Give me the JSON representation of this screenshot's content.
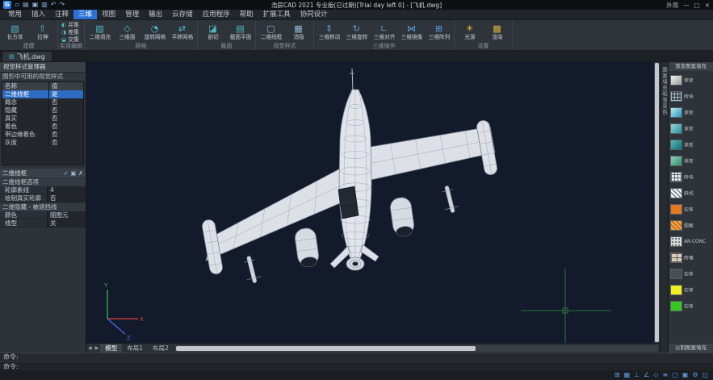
{
  "window": {
    "logo_text": "G",
    "title": "浩辰CAD 2021 专业版(已过期)[Trial day left 0] - [飞机.dwg]",
    "appearance": "外观",
    "minimize": "—",
    "maximize": "□",
    "close": "×"
  },
  "quick_access": {
    "icons": [
      {
        "name": "new-file-icon",
        "glyph": "▱"
      },
      {
        "name": "open-folder-icon",
        "glyph": "▤"
      },
      {
        "name": "save-icon",
        "glyph": "▣"
      },
      {
        "name": "plot-icon",
        "glyph": "▥"
      },
      {
        "name": "undo-icon",
        "glyph": "↶"
      },
      {
        "name": "redo-icon",
        "glyph": "↷"
      }
    ]
  },
  "menu": {
    "tabs": [
      {
        "label": "常用"
      },
      {
        "label": "插入"
      },
      {
        "label": "注释"
      },
      {
        "label": "三维",
        "active": true
      },
      {
        "label": "视图"
      },
      {
        "label": "管理"
      },
      {
        "label": "输出"
      },
      {
        "label": "云存储"
      },
      {
        "label": "应用程序"
      },
      {
        "label": "帮助"
      },
      {
        "label": "扩展工具"
      },
      {
        "label": "协同设计"
      }
    ]
  },
  "ribbon": {
    "groups": [
      {
        "label": "建模",
        "icon_color": "#4db8c8",
        "buttons": [
          {
            "label": "长方体",
            "icon": "▧"
          },
          {
            "label": "拉伸",
            "icon": "⇧"
          }
        ]
      },
      {
        "label": "实体编辑",
        "icon_color": "#4db8c8",
        "stack": true,
        "buttons": [
          {
            "label": "并集",
            "icon": "◐"
          },
          {
            "label": "差集",
            "icon": "◑"
          },
          {
            "label": "交集",
            "icon": "◒"
          }
        ]
      },
      {
        "label": "网格",
        "icon_color": "#4db8c8",
        "buttons": [
          {
            "label": "二维填充",
            "icon": "▨"
          },
          {
            "label": "三维面",
            "icon": "◇"
          },
          {
            "label": "旋转网格",
            "icon": "◔"
          },
          {
            "label": "平移网格",
            "icon": "⇄"
          }
        ]
      },
      {
        "label": "截面",
        "icon_color": "#4db8c8",
        "buttons": [
          {
            "label": "剖切",
            "icon": "◪"
          },
          {
            "label": "截面平面",
            "icon": "▤"
          }
        ]
      },
      {
        "label": "视觉样式",
        "icon_color": "#8fb7d8",
        "buttons": [
          {
            "label": "二维线框",
            "icon": "▢"
          },
          {
            "label": "消隐",
            "icon": "▦"
          }
        ]
      },
      {
        "label": "三维操作",
        "icon_color": "#5a9fe0",
        "buttons": [
          {
            "label": "三维移动",
            "icon": "⇕"
          },
          {
            "label": "三维旋转",
            "icon": "↻"
          },
          {
            "label": "三维对齐",
            "icon": "∟"
          },
          {
            "label": "三维镜像",
            "icon": "⋈"
          },
          {
            "label": "三维阵列",
            "icon": "⊞"
          }
        ]
      },
      {
        "label": "设置",
        "icon_color": "#d8b23f",
        "buttons": [
          {
            "label": "光源",
            "icon": "☀"
          },
          {
            "label": "渲染",
            "icon": "▩"
          }
        ]
      }
    ]
  },
  "doc_tabs": {
    "icon": "▤",
    "tabs": [
      {
        "label": "飞机.dwg",
        "active": true
      }
    ]
  },
  "left_panel": {
    "title": "视觉样式管理器",
    "list_title": "图形中可用的视觉样式",
    "table": {
      "headers": [
        "名称",
        "值"
      ],
      "rows": [
        [
          "二维线框",
          "是"
        ],
        [
          "概念",
          "否"
        ],
        [
          "隐藏",
          "否"
        ],
        [
          "真实",
          "否"
        ],
        [
          "着色",
          "否"
        ],
        [
          "带边缘着色",
          "否"
        ],
        [
          "灰度",
          "否"
        ]
      ],
      "selected_index": 0
    },
    "section_title": "二维线框",
    "section_icons": [
      {
        "name": "apply-visual-style-icon",
        "glyph": "✓"
      },
      {
        "name": "new-visual-style-icon",
        "glyph": "▣"
      },
      {
        "name": "delete-visual-style-icon",
        "glyph": "✗"
      }
    ],
    "prop_groups": [
      {
        "title": "二维线框选项",
        "rows": [
          [
            "轮廓素线",
            "4"
          ],
          [
            "绘制真实轮廓",
            "否"
          ]
        ]
      },
      {
        "title": "二维隐藏 - 被遮挡线",
        "rows": [
          [
            "颜色",
            "随图元"
          ],
          [
            "线型",
            "关"
          ]
        ]
      }
    ]
  },
  "viewport": {
    "background": "#131a2b",
    "nav_prev": "◀",
    "nav_next": "▶",
    "model_tabs": [
      {
        "label": "模型",
        "active": true
      },
      {
        "label": "布局1"
      },
      {
        "label": "布局2"
      }
    ],
    "ucs": {
      "x_label": "X",
      "x_color": "#e04040",
      "y_label": "Y",
      "y_color": "#35c435",
      "z_label": "Z",
      "z_color": "#4070e8"
    },
    "crosshair_color": "#2e8f3e"
  },
  "right_panel": {
    "vertical_tab": "图案填充和渐变色",
    "group_top": "渐变图案填充",
    "group_bottom": "公制图案填充",
    "items": [
      {
        "label": "渐变",
        "kind": "gradient",
        "c1": "#f2f2f2",
        "c2": "#9a9a9a"
      },
      {
        "label": "砖块",
        "kind": "grid",
        "c1": "#3a3f45",
        "c2": "#9fb6c9"
      },
      {
        "label": "渐变",
        "kind": "gradient",
        "c1": "#bfe9f2",
        "c2": "#1f9ab8"
      },
      {
        "label": "渐变",
        "kind": "gradient",
        "c1": "#9fd8d8",
        "c2": "#1f8f9f"
      },
      {
        "label": "渐变",
        "kind": "gradient",
        "c1": "#57b8b0",
        "c2": "#0f6f7f"
      },
      {
        "label": "渐变",
        "kind": "gradient",
        "c1": "#8fd0b8",
        "c2": "#2f8f6f"
      },
      {
        "label": "砖块",
        "kind": "grid",
        "c1": "#e8eef2",
        "c2": "#5a6570"
      },
      {
        "label": "斜线",
        "kind": "diag",
        "c1": "#e8eef2",
        "c2": "#5a6570"
      },
      {
        "label": "实体",
        "kind": "solid",
        "c1": "#e87820"
      },
      {
        "label": "图案",
        "kind": "diag",
        "c1": "#f0a040",
        "c2": "#b05a10"
      },
      {
        "label": "AR-CONC",
        "kind": "speckle",
        "c1": "#d8d8d8",
        "c2": "#555555"
      },
      {
        "label": "砖墙",
        "kind": "brick",
        "c1": "#d8cfc0",
        "c2": "#6a5a4a"
      },
      {
        "label": "实体",
        "kind": "solid",
        "c1": "#4a4f55"
      },
      {
        "label": "实体",
        "kind": "solid",
        "c1": "#f2ef1f"
      },
      {
        "label": "实体",
        "kind": "solid",
        "c1": "#35c91f"
      }
    ]
  },
  "command": {
    "lines": [
      "命令:",
      "命令:"
    ]
  },
  "status_bar": {
    "icons": [
      {
        "name": "snap-icon",
        "glyph": "⊞"
      },
      {
        "name": "grid-icon",
        "glyph": "▦"
      },
      {
        "name": "ortho-icon",
        "glyph": "⊥"
      },
      {
        "name": "polar-tracking-icon",
        "glyph": "∠"
      },
      {
        "name": "object-snap-icon",
        "glyph": "◇"
      },
      {
        "name": "lineweight-icon",
        "glyph": "≡"
      },
      {
        "name": "dynamic-input-icon",
        "glyph": "▢"
      },
      {
        "name": "model-space-icon",
        "glyph": "▣"
      },
      {
        "name": "settings-icon",
        "glyph": "⚙"
      },
      {
        "name": "fullscreen-icon",
        "glyph": "◱"
      }
    ]
  }
}
